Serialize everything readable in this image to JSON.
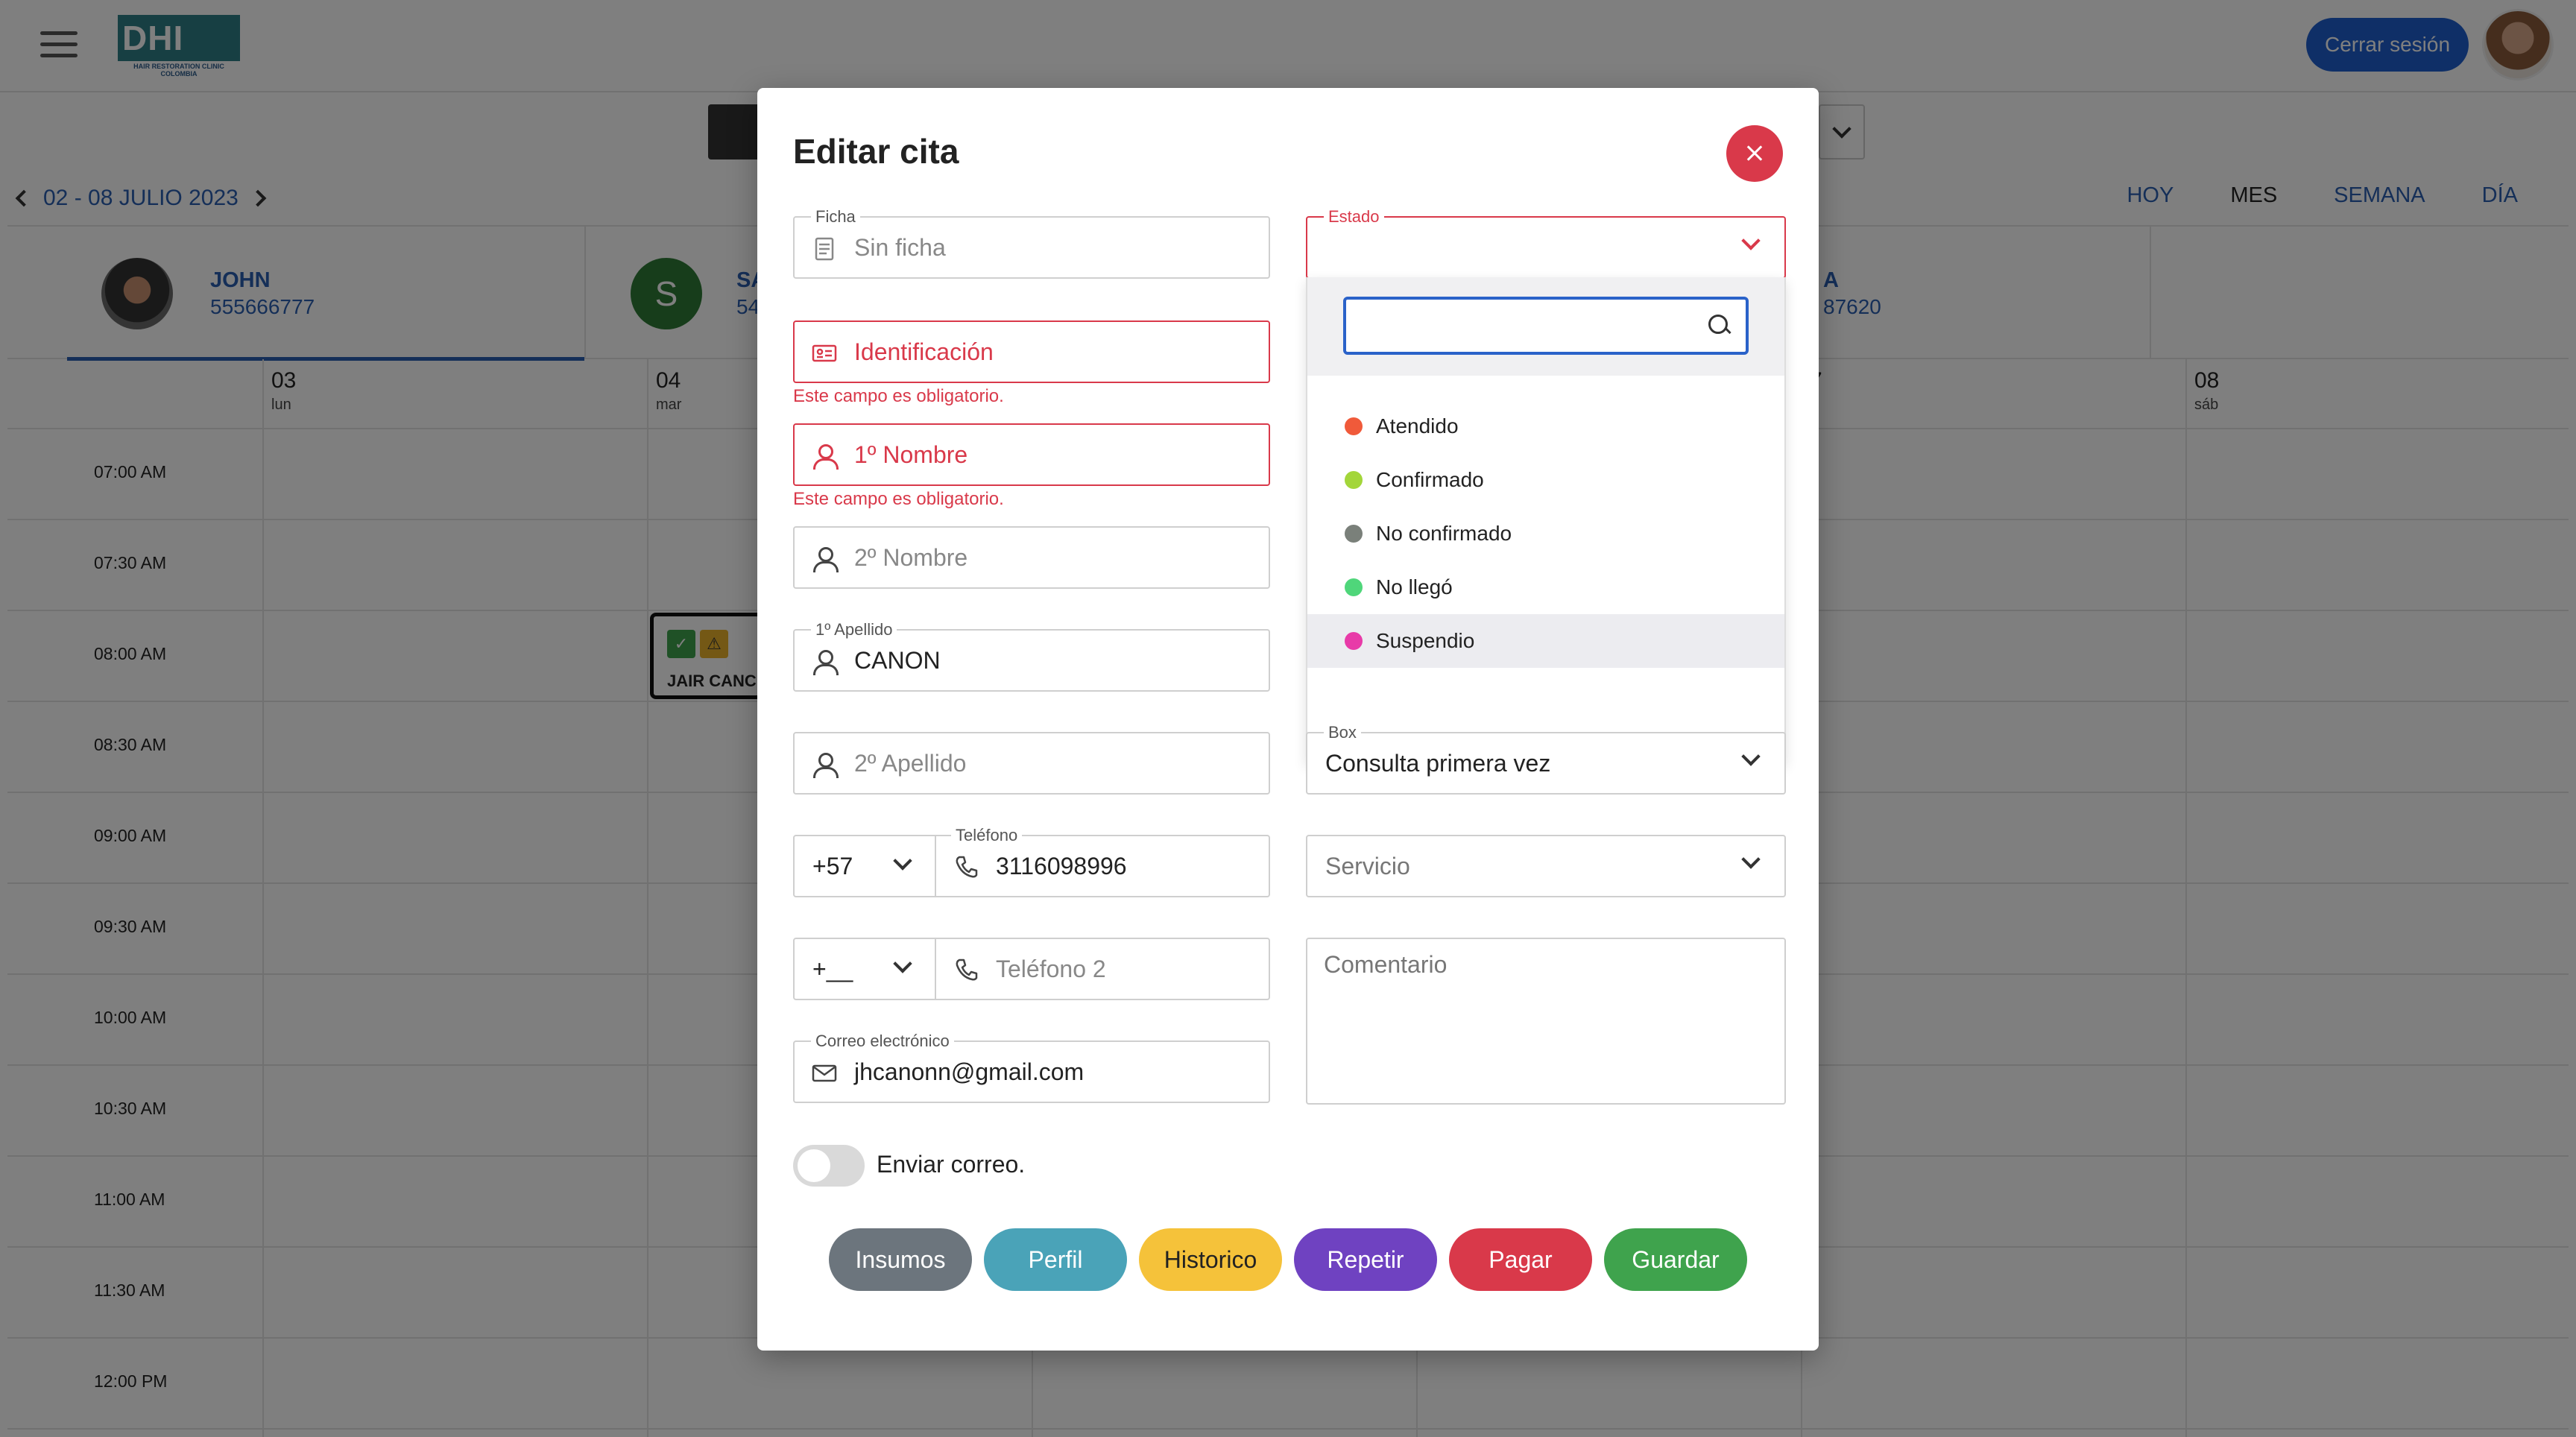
{
  "app": {
    "logo_text": "DHI",
    "logo_sub": "HAIR RESTORATION CLINIC COLOMBIA",
    "logout_label": "Cerrar sesión"
  },
  "calendar": {
    "range_label": "02 - 08 JULIO 2023",
    "views": [
      "HOY",
      "MES",
      "SEMANA",
      "DÍA"
    ],
    "active_view": "MES",
    "professionals": [
      {
        "name": "JOHN",
        "phone": "555666777"
      },
      {
        "name": "SA",
        "phone": "54",
        "initial": "S"
      },
      {
        "name": "A",
        "phone": "87620"
      }
    ],
    "days": [
      {
        "num": "03",
        "name": "lun"
      },
      {
        "num": "04",
        "name": "mar"
      },
      {
        "num": "7",
        "name": "e"
      },
      {
        "num": "08",
        "name": "sáb"
      }
    ],
    "hours": [
      "07:00 AM",
      "07:30 AM",
      "08:00 AM",
      "08:30 AM",
      "09:00 AM",
      "09:30 AM",
      "10:00 AM",
      "10:30 AM",
      "11:00 AM",
      "11:30 AM",
      "12:00 PM"
    ],
    "appointment": {
      "name": "JAIR CANC",
      "check_icon": "✓",
      "warn_icon": "⚠"
    }
  },
  "modal": {
    "title": "Editar cita",
    "ficha": {
      "legend": "Ficha",
      "placeholder": "Sin ficha"
    },
    "identificacion": {
      "placeholder": "Identificación",
      "error": "Este campo es obligatorio."
    },
    "nombre1": {
      "placeholder": "1º Nombre",
      "error": "Este campo es obligatorio."
    },
    "nombre2": {
      "placeholder": "2º Nombre"
    },
    "apellido1": {
      "legend": "1º Apellido",
      "value": "CANON"
    },
    "apellido2": {
      "placeholder": "2º Apellido"
    },
    "telefono": {
      "legend": "Teléfono",
      "code": "+57",
      "value": "3116098996"
    },
    "telefono2": {
      "code": "+__",
      "placeholder": "Teléfono 2"
    },
    "correo": {
      "legend": "Correo electrónico",
      "value": "jhcanonn@gmail.com"
    },
    "estado": {
      "legend": "Estado",
      "options": [
        {
          "label": "Atendido",
          "color": "#f05a3a"
        },
        {
          "label": "Confirmado",
          "color": "#a3d63a"
        },
        {
          "label": "No confirmado",
          "color": "#7a807a"
        },
        {
          "label": "No llegó",
          "color": "#4fd67a"
        },
        {
          "label": "Suspendio",
          "color": "#e83aa8"
        }
      ]
    },
    "box": {
      "legend": "Box",
      "value": "Consulta primera vez"
    },
    "servicio": {
      "placeholder": "Servicio"
    },
    "comentario": {
      "placeholder": "Comentario"
    },
    "enviar_correo": "Enviar correo.",
    "buttons": [
      {
        "label": "Insumos",
        "color": "#6c757d"
      },
      {
        "label": "Perfil",
        "color": "#4aa3b8"
      },
      {
        "label": "Historico",
        "color": "#f5c23a"
      },
      {
        "label": "Repetir",
        "color": "#6f42c1"
      },
      {
        "label": "Pagar",
        "color": "#d9394a"
      },
      {
        "label": "Guardar",
        "color": "#3fa34d"
      }
    ]
  }
}
